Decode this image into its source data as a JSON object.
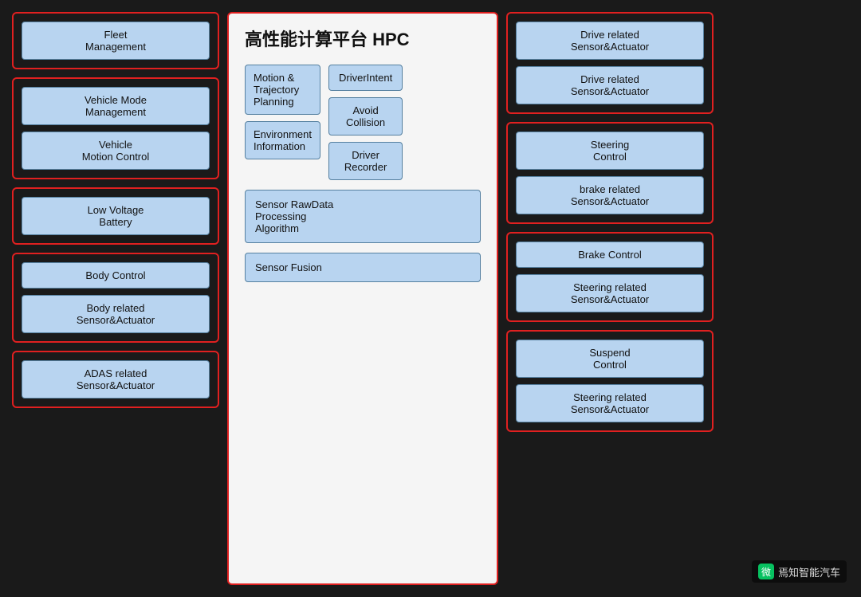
{
  "title": "高性能计算平台 HPC",
  "left_column": {
    "boxes": [
      {
        "id": "fleet",
        "items": [
          "Fleet Management"
        ]
      },
      {
        "id": "vehicle-mode",
        "items": [
          "Vehicle Mode Management",
          "Vehicle Motion Control"
        ]
      },
      {
        "id": "battery",
        "items": [
          "Low Voltage Battery"
        ]
      },
      {
        "id": "body",
        "items": [
          "Body Control",
          "Body related Sensor&Actuator"
        ]
      },
      {
        "id": "adas",
        "items": [
          "ADAS related Sensor&Actuator"
        ]
      }
    ]
  },
  "center_column": {
    "title": "高性能计算平台",
    "title_bold": "HPC",
    "row1": {
      "left": [
        "Motion & Trajectory Planning",
        "Environment Information"
      ],
      "right": [
        "DriverIntent",
        "Avoid Collision",
        "Driver Recorder"
      ]
    },
    "row2": [
      "Sensor RawData Processing Algorithm"
    ],
    "row3": [
      "Sensor Fusion"
    ]
  },
  "right_column": {
    "boxes": [
      {
        "id": "drive-sensors",
        "items": [
          "Drive related Sensor&Actuator",
          "Drive related Sensor&Actuator"
        ]
      },
      {
        "id": "steering-brake",
        "items": [
          "Steering Control",
          "brake related Sensor&Actuator"
        ]
      },
      {
        "id": "brake-steering",
        "items": [
          "Brake Control",
          "Steering related Sensor&Actuator"
        ]
      },
      {
        "id": "suspend",
        "items": [
          "Suspend Control",
          "Steering related Sensor&Actuator"
        ]
      }
    ]
  },
  "watermark": "焉知智能汽车"
}
